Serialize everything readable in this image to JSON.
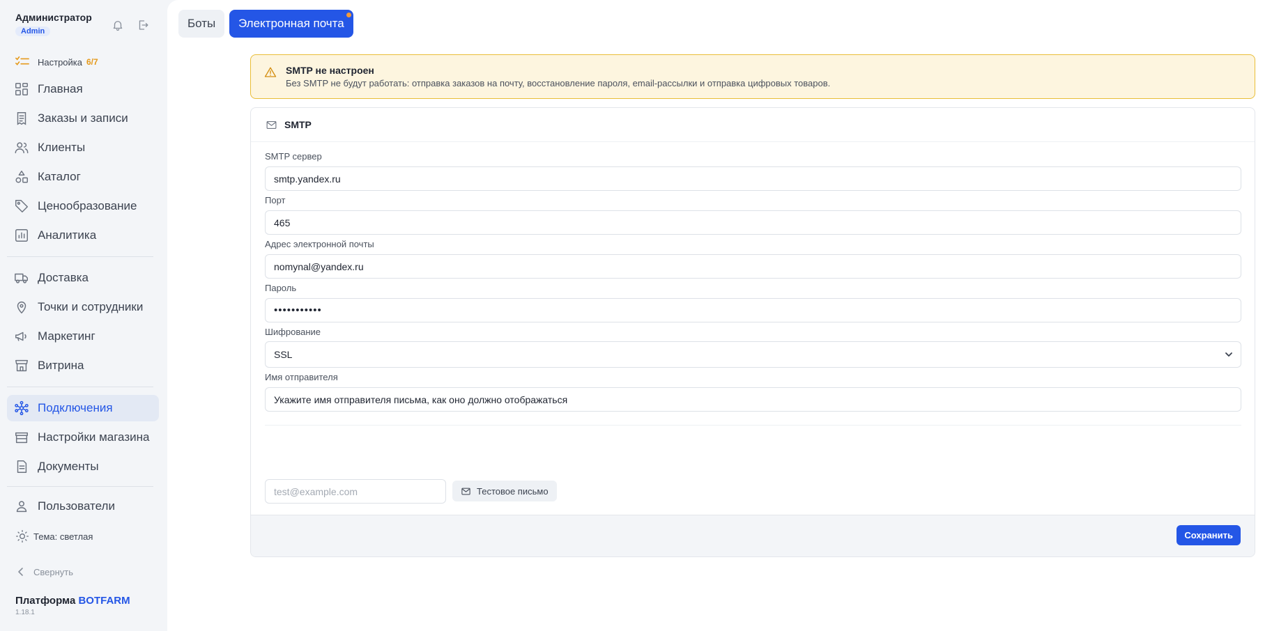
{
  "user": {
    "name": "Администратор",
    "role": "Admin"
  },
  "setup": {
    "label": "Настройка",
    "progress": "6/7"
  },
  "nav": {
    "home": "Главная",
    "orders": "Заказы и записи",
    "clients": "Клиенты",
    "catalog": "Каталог",
    "pricing": "Ценообразование",
    "analytics": "Аналитика",
    "delivery": "Доставка",
    "locations": "Точки и сотрудники",
    "marketing": "Маркетинг",
    "storefront": "Витрина",
    "connections": "Подключения",
    "store_settings": "Настройки магазина",
    "documents": "Документы",
    "users": "Пользователи"
  },
  "theme": "Тема: светлая",
  "collapse": "Свернуть",
  "brand": {
    "prefix": "Платформа",
    "name": "BOTFARM"
  },
  "version": "1.18.1",
  "tabs": {
    "bots": "Боты",
    "email": "Электронная почта"
  },
  "alert": {
    "title": "SMTP не настроен",
    "text": "Без SMTP не будут работать: отправка заказов на почту, восстановление пароля, email-рассылки и отправка цифровых товаров."
  },
  "card": {
    "title": "SMTP"
  },
  "form": {
    "server_label": "SMTP сервер",
    "server_value": "smtp.yandex.ru",
    "port_label": "Порт",
    "port_value": "465",
    "email_label": "Адрес электронной почты",
    "email_value": "nomynal@yandex.ru",
    "password_label": "Пароль",
    "password_value": "•••••••••••",
    "encryption_label": "Шифрование",
    "encryption_value": "SSL",
    "sender_label": "Имя отправителя",
    "sender_value": "Укажите имя отправителя письма, как оно должно отображаться"
  },
  "test": {
    "placeholder": "test@example.com",
    "button": "Тестовое письмо"
  },
  "save_label": "Сохранить",
  "colors": {
    "accent": "#2456e6",
    "warning_bg": "#fdf5df",
    "warning_border": "#e9bd37",
    "setup_orange": "#e59a1c"
  }
}
